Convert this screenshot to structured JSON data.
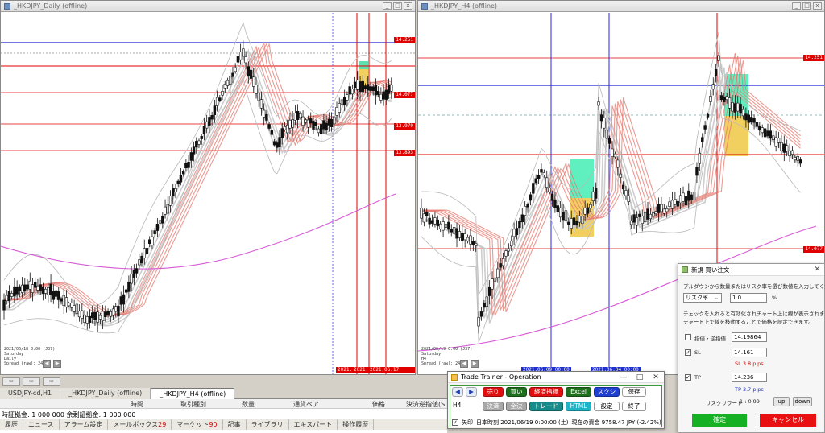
{
  "left_chart": {
    "title": "_HKDJPY_Daily (offline)",
    "price_tags": [
      {
        "text": "14.251",
        "color": "#e00000"
      },
      {
        "text": "14.077",
        "color": "#e00000"
      },
      {
        "text": "13.979",
        "color": "#e00000"
      },
      {
        "text": "13.893",
        "color": "#e00000"
      }
    ],
    "info_lines": [
      "2021/06/18 0:00 (J37)",
      "Saturday",
      "Daily",
      "Spread (raw):  24"
    ],
    "time_tags": [
      "2021.",
      "2021.06.0",
      "2021.06.17 00:00"
    ]
  },
  "right_chart": {
    "title": "_HKDJPY_H4 (offline)",
    "price_tags": [
      {
        "text": "14.251",
        "color": "#e00000"
      },
      {
        "text": "14.077",
        "color": "#e00000"
      }
    ],
    "info_lines": [
      "2021/06/19 0:00 (J37)",
      "Saturday",
      "H4",
      "Spread (raw):  24"
    ],
    "time_tags": [
      "2021.06.09 00:00",
      "2021.06.04 00:00"
    ]
  },
  "chart_tabs": [
    "USDJPY-cd,H1",
    "_HKDJPY_Daily (offline)",
    "_HKDJPY_H4 (offline)"
  ],
  "terminal": {
    "columns": [
      "時間",
      "取引種別",
      "数量",
      "通貨ペア",
      "価格",
      "決済逆指値(S"
    ],
    "balance": "時証拠金: 1 000 000  余剰証拠金: 1 000 000"
  },
  "statusbar": [
    {
      "label": "履歴",
      "count": ""
    },
    {
      "label": "ニュース",
      "count": ""
    },
    {
      "label": "アラーム設定",
      "count": ""
    },
    {
      "label": "メールボックス",
      "count": "29"
    },
    {
      "label": "マーケット",
      "count": "90"
    },
    {
      "label": "記事",
      "count": ""
    },
    {
      "label": "ライブラリ",
      "count": ""
    },
    {
      "label": "エキスパート",
      "count": ""
    },
    {
      "label": "操作履歴",
      "count": ""
    }
  ],
  "trade_trainer": {
    "title": "Trade Trainer - Operation",
    "timeframe": "H4",
    "buttons": {
      "sell": "売り",
      "buy": "買い",
      "economic": "経済指標",
      "excel": "Excel",
      "screenshot": "スクショ",
      "save": "保存",
      "close_pos": "決済",
      "close_all": "全決済",
      "trade": "トレード",
      "html": "HTML",
      "settings": "設定",
      "exit": "終了"
    },
    "status": {
      "check_label": "矢印",
      "time": "日本時刻 2021/06/19 0:00:00 (土)",
      "equity": "現在の資金 9758.47 JPY (-2.42%)"
    }
  },
  "order_dialog": {
    "title": "新規 買い注文",
    "instruction": "プルダウンから数量またはリスク率を選び数値を入力してください。",
    "mode_select": "リスク率",
    "risk_value": "1.0",
    "percent": "%",
    "note1": "チェックを入れると有効化されチャート上に線が表示されます。",
    "note2": "チャート上で線を移動することで価格を設定できます。",
    "entry_label": "指値・逆指値",
    "entry_value": "14.19864",
    "sl_label": "SL",
    "sl_value": "14.161",
    "sl_pips": "SL 3.8 pips",
    "tp_label": "TP",
    "tp_value": "14.236",
    "tp_pips": "TP 3.7 pips",
    "rr_label": "リスクリワード",
    "rr_value": "1 : 0.99",
    "up": "up",
    "down": "down",
    "confirm": "確定",
    "cancel": "キャンセル"
  }
}
